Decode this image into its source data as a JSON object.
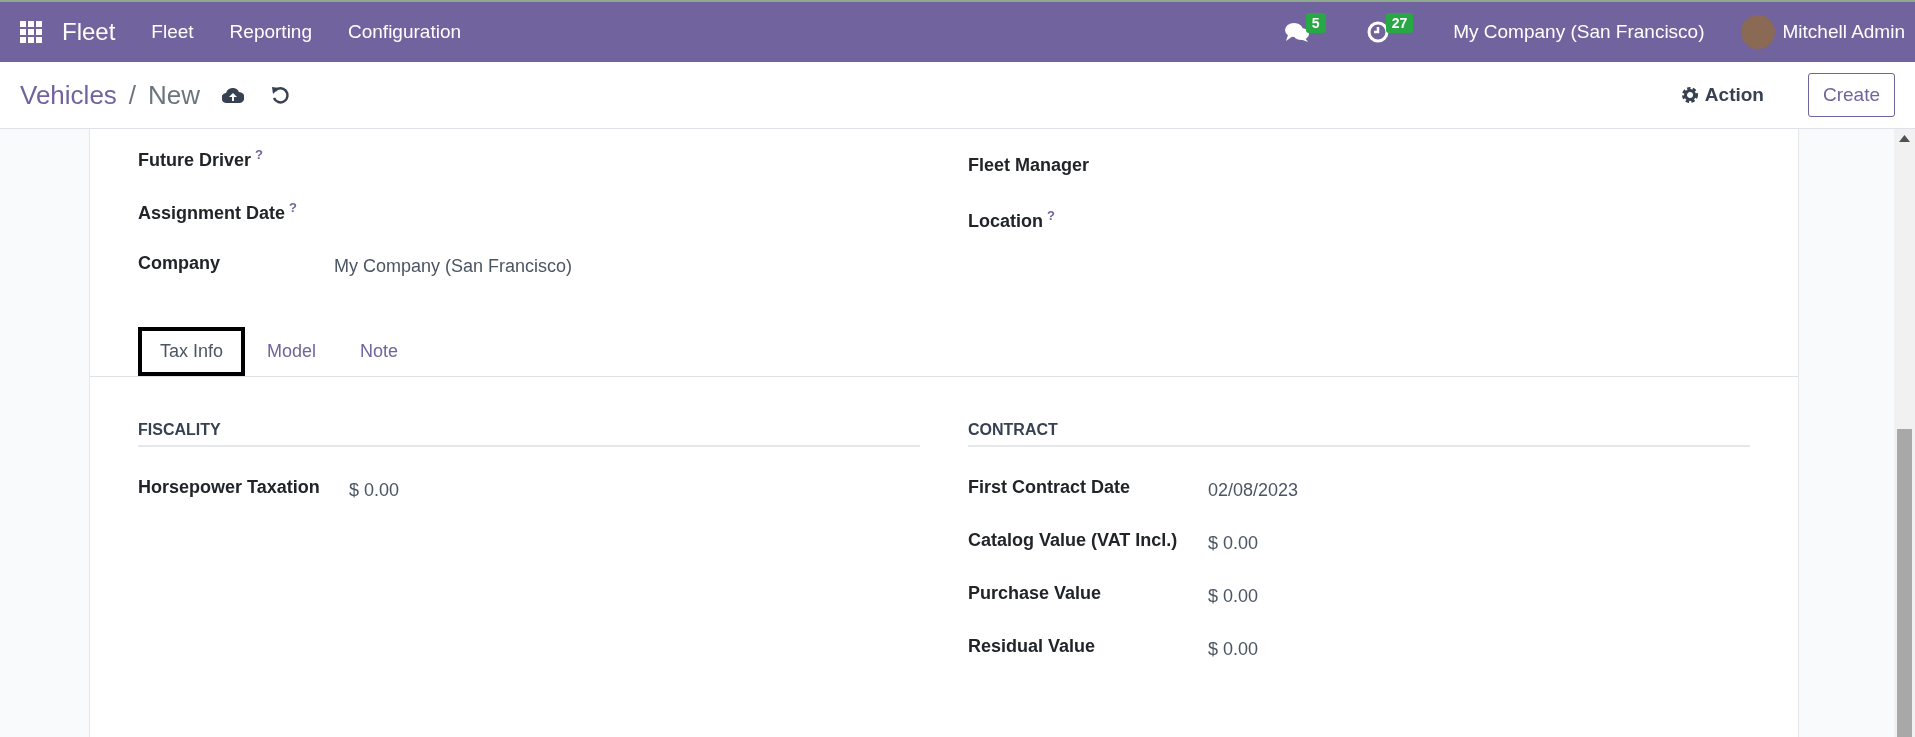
{
  "navbar": {
    "app_name": "Fleet",
    "menu": [
      "Fleet",
      "Reporting",
      "Configuration"
    ],
    "messages_count": "5",
    "activities_count": "27",
    "company": "My Company (San Francisco)",
    "user": "Mitchell Admin"
  },
  "control_panel": {
    "breadcrumb": [
      "Vehicles",
      "New"
    ],
    "separator": "/",
    "action": "Action",
    "create": "Create"
  },
  "form": {
    "left_fields": [
      {
        "label": "Future Driver",
        "help": "?"
      },
      {
        "label": "Assignment Date",
        "help": "?"
      },
      {
        "label": "Company",
        "value": "My Company (San Francisco)"
      }
    ],
    "right_fields": [
      {
        "label": "Fleet Manager"
      },
      {
        "label": "Location",
        "help": "?"
      }
    ],
    "tabs": [
      {
        "label": "Tax Info",
        "selected": true
      },
      {
        "label": "Model",
        "selected": false
      },
      {
        "label": "Note",
        "selected": false
      }
    ],
    "groups": [
      {
        "title": "FISCALITY",
        "fields": [
          {
            "label": "Horsepower Taxation",
            "value": "$ 0.00"
          }
        ]
      },
      {
        "title": "CONTRACT",
        "fields": [
          {
            "label": "First Contract Date",
            "value": "02/08/2023"
          },
          {
            "label": "Catalog Value (VAT Incl.)",
            "value": "$ 0.00"
          },
          {
            "label": "Purchase Value",
            "value": "$ 0.00"
          },
          {
            "label": "Residual Value",
            "value": "$ 0.00"
          }
        ]
      }
    ]
  }
}
